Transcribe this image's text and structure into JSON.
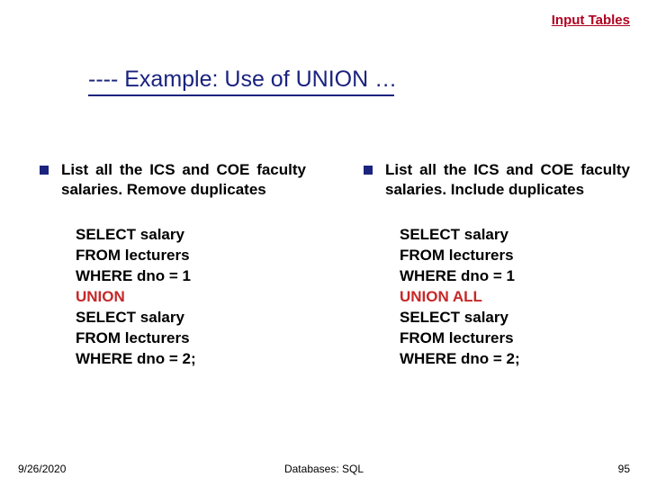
{
  "topLink": "Input Tables",
  "title": "---- Example: Use of UNION …",
  "left": {
    "heading": "List all the ICS and COE faculty salaries. Remove duplicates",
    "sql": {
      "l1": "SELECT salary",
      "l2": "FROM lecturers",
      "l3": "WHERE dno = 1",
      "kw": "UNION",
      "l5": "SELECT salary",
      "l6": "FROM lecturers",
      "l7": "WHERE dno = 2;"
    }
  },
  "right": {
    "heading": "List all the ICS and COE faculty salaries. Include duplicates",
    "sql": {
      "l1": "SELECT salary",
      "l2": "FROM lecturers",
      "l3": "WHERE dno = 1",
      "kw": "UNION ALL",
      "l5": "SELECT salary",
      "l6": "FROM lecturers",
      "l7": "WHERE dno = 2;"
    }
  },
  "footer": {
    "date": "9/26/2020",
    "center": "Databases: SQL",
    "page": "95"
  }
}
